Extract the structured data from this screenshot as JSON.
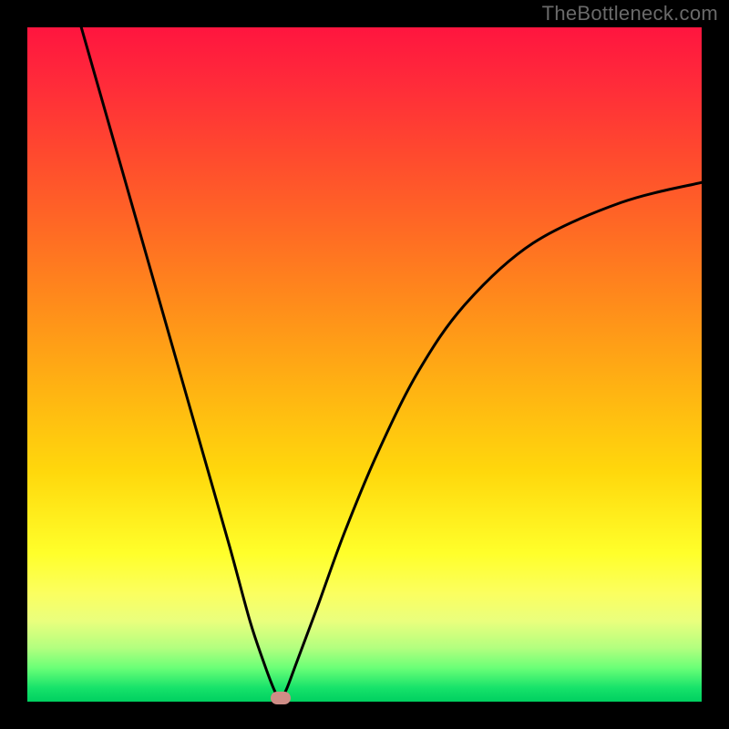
{
  "chart_data": {
    "type": "line",
    "title": "",
    "xlabel": "",
    "ylabel": "",
    "xlim": [
      0,
      100
    ],
    "ylim": [
      0,
      100
    ],
    "grid": false,
    "attribution": "TheBottleneck.com",
    "series": [
      {
        "name": "bottleneck-curve",
        "color": "#000000",
        "x": [
          8,
          10,
          14,
          18,
          22,
          26,
          30,
          33,
          35,
          36.5,
          37.2,
          37.8,
          38.5,
          40,
          43,
          47,
          52,
          58,
          65,
          75,
          88,
          100
        ],
        "y": [
          100,
          93,
          79,
          65,
          51,
          37,
          23,
          12,
          6,
          2,
          0.8,
          0.8,
          2,
          6,
          14,
          25,
          37,
          49,
          59,
          68,
          74,
          77
        ]
      }
    ],
    "annotations": [
      {
        "name": "optimal-point",
        "x": 37.5,
        "y": 0.5,
        "shape": "pill",
        "color": "#cf8d86"
      }
    ],
    "background_gradient": {
      "direction": "vertical",
      "stops": [
        {
          "pos": 0.0,
          "color": "#ff153f"
        },
        {
          "pos": 0.5,
          "color": "#ffb412"
        },
        {
          "pos": 0.78,
          "color": "#ffff2a"
        },
        {
          "pos": 1.0,
          "color": "#00d060"
        }
      ]
    }
  },
  "attribution_text": "TheBottleneck.com"
}
